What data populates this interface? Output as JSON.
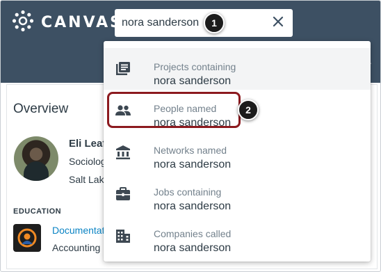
{
  "brand": {
    "name": "CANVAS",
    "logo_icon": "canvas-logo-icon"
  },
  "search": {
    "value": "nora sanderson",
    "placeholder": "",
    "clear_icon": "close-icon"
  },
  "callouts": [
    "1",
    "2"
  ],
  "nav_hint": "T",
  "overview": {
    "title": "Overview",
    "profile": {
      "name": "Eli Leaf",
      "line1": "Sociolog",
      "line2": "Salt Lake"
    },
    "education_label": "EDUCATION",
    "education": {
      "link": "Documentat",
      "sub": "Accounting"
    },
    "right_hint": "t"
  },
  "suggestions": [
    {
      "label": "Projects containing",
      "value": "nora sanderson",
      "icon": "projects-icon"
    },
    {
      "label": "People named",
      "value": "nora sanderson",
      "icon": "people-icon"
    },
    {
      "label": "Networks named",
      "value": "nora sanderson",
      "icon": "networks-icon"
    },
    {
      "label": "Jobs containing",
      "value": "nora sanderson",
      "icon": "jobs-icon"
    },
    {
      "label": "Companies called",
      "value": "nora sanderson",
      "icon": "companies-icon"
    }
  ],
  "colors": {
    "topbar": "#3d5063",
    "highlight": "#8c1a1f",
    "link": "#0b84c4"
  }
}
